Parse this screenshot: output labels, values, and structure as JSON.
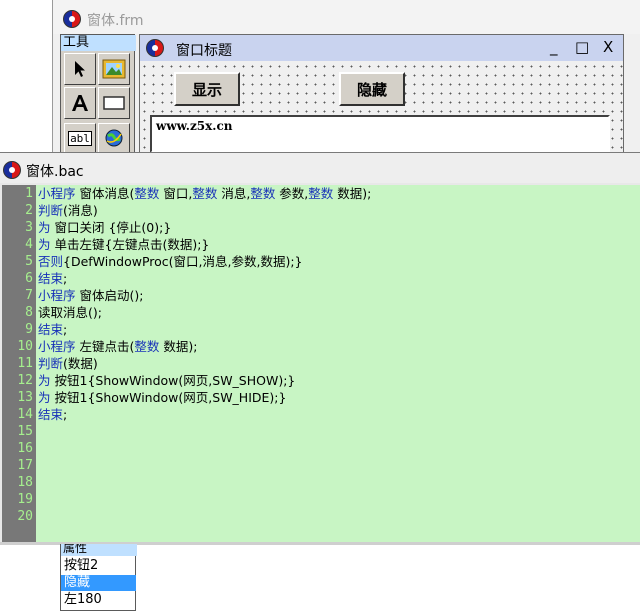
{
  "bg_window": {
    "title": "窗体.frm"
  },
  "toolbox": {
    "title": "工具",
    "abl_label": "abl"
  },
  "design_window": {
    "title": "窗口标题",
    "min": "_",
    "max": "□",
    "close": "X",
    "show_button": "显示",
    "hide_button": "隐藏",
    "textbox_text": "www.z5x.cn"
  },
  "code_window": {
    "title": "窗体.bac",
    "line_numbers": [
      "1",
      "2",
      "3",
      "4",
      "5",
      "6",
      "7",
      "8",
      "9",
      "10",
      "11",
      "12",
      "13",
      "14",
      "15",
      "16",
      "17",
      "18",
      "19",
      "20"
    ],
    "lines": [
      [
        {
          "t": "小程序",
          "k": 1
        },
        {
          "t": " 窗体消息("
        },
        {
          "t": "整数",
          "k": 1
        },
        {
          "t": " 窗口,"
        },
        {
          "t": "整数",
          "k": 1
        },
        {
          "t": " 消息,"
        },
        {
          "t": "整数",
          "k": 1
        },
        {
          "t": " 参数,"
        },
        {
          "t": "整数",
          "k": 1
        },
        {
          "t": " 数据);"
        }
      ],
      [
        {
          "t": "判断",
          "k": 1
        },
        {
          "t": "(消息)"
        }
      ],
      [
        {
          "t": "为",
          "k": 1
        },
        {
          "t": " 窗口关闭 {停止(0);}"
        }
      ],
      [
        {
          "t": "为",
          "k": 1
        },
        {
          "t": " 单击左键{左键点击(数据);}"
        }
      ],
      [
        {
          "t": "否则",
          "k": 1
        },
        {
          "t": "{DefWindowProc(窗口,消息,参数,数据);}"
        }
      ],
      [
        {
          "t": "结束",
          "k": 1
        },
        {
          "t": ";"
        }
      ],
      [
        {
          "t": "小程序",
          "k": 1
        },
        {
          "t": " 窗体启动();"
        }
      ],
      [
        {
          "t": "读取消息();"
        }
      ],
      [
        {
          "t": "结束",
          "k": 1
        },
        {
          "t": ";"
        }
      ],
      [
        {
          "t": "小程序",
          "k": 1
        },
        {
          "t": " 左键点击("
        },
        {
          "t": "整数",
          "k": 1
        },
        {
          "t": " 数据);"
        }
      ],
      [
        {
          "t": "判断",
          "k": 1
        },
        {
          "t": "(数据)"
        }
      ],
      [
        {
          "t": "为",
          "k": 1
        },
        {
          "t": " 按钮1{ShowWindow(网页,SW_SHOW);}"
        }
      ],
      [
        {
          "t": "为",
          "k": 1
        },
        {
          "t": " 按钮1{ShowWindow(网页,SW_HIDE);}"
        }
      ],
      [
        {
          "t": "结束",
          "k": 1
        },
        {
          "t": ";"
        }
      ]
    ]
  },
  "properties": {
    "title": "属性",
    "items": [
      "按钮2",
      "隐藏",
      "左180"
    ],
    "selected_index": 1
  },
  "colors": {
    "editor_bg": "#c8f5c4",
    "keyword": "#1832b8",
    "gutter": "#787878",
    "line_number": "#a6f08e"
  }
}
